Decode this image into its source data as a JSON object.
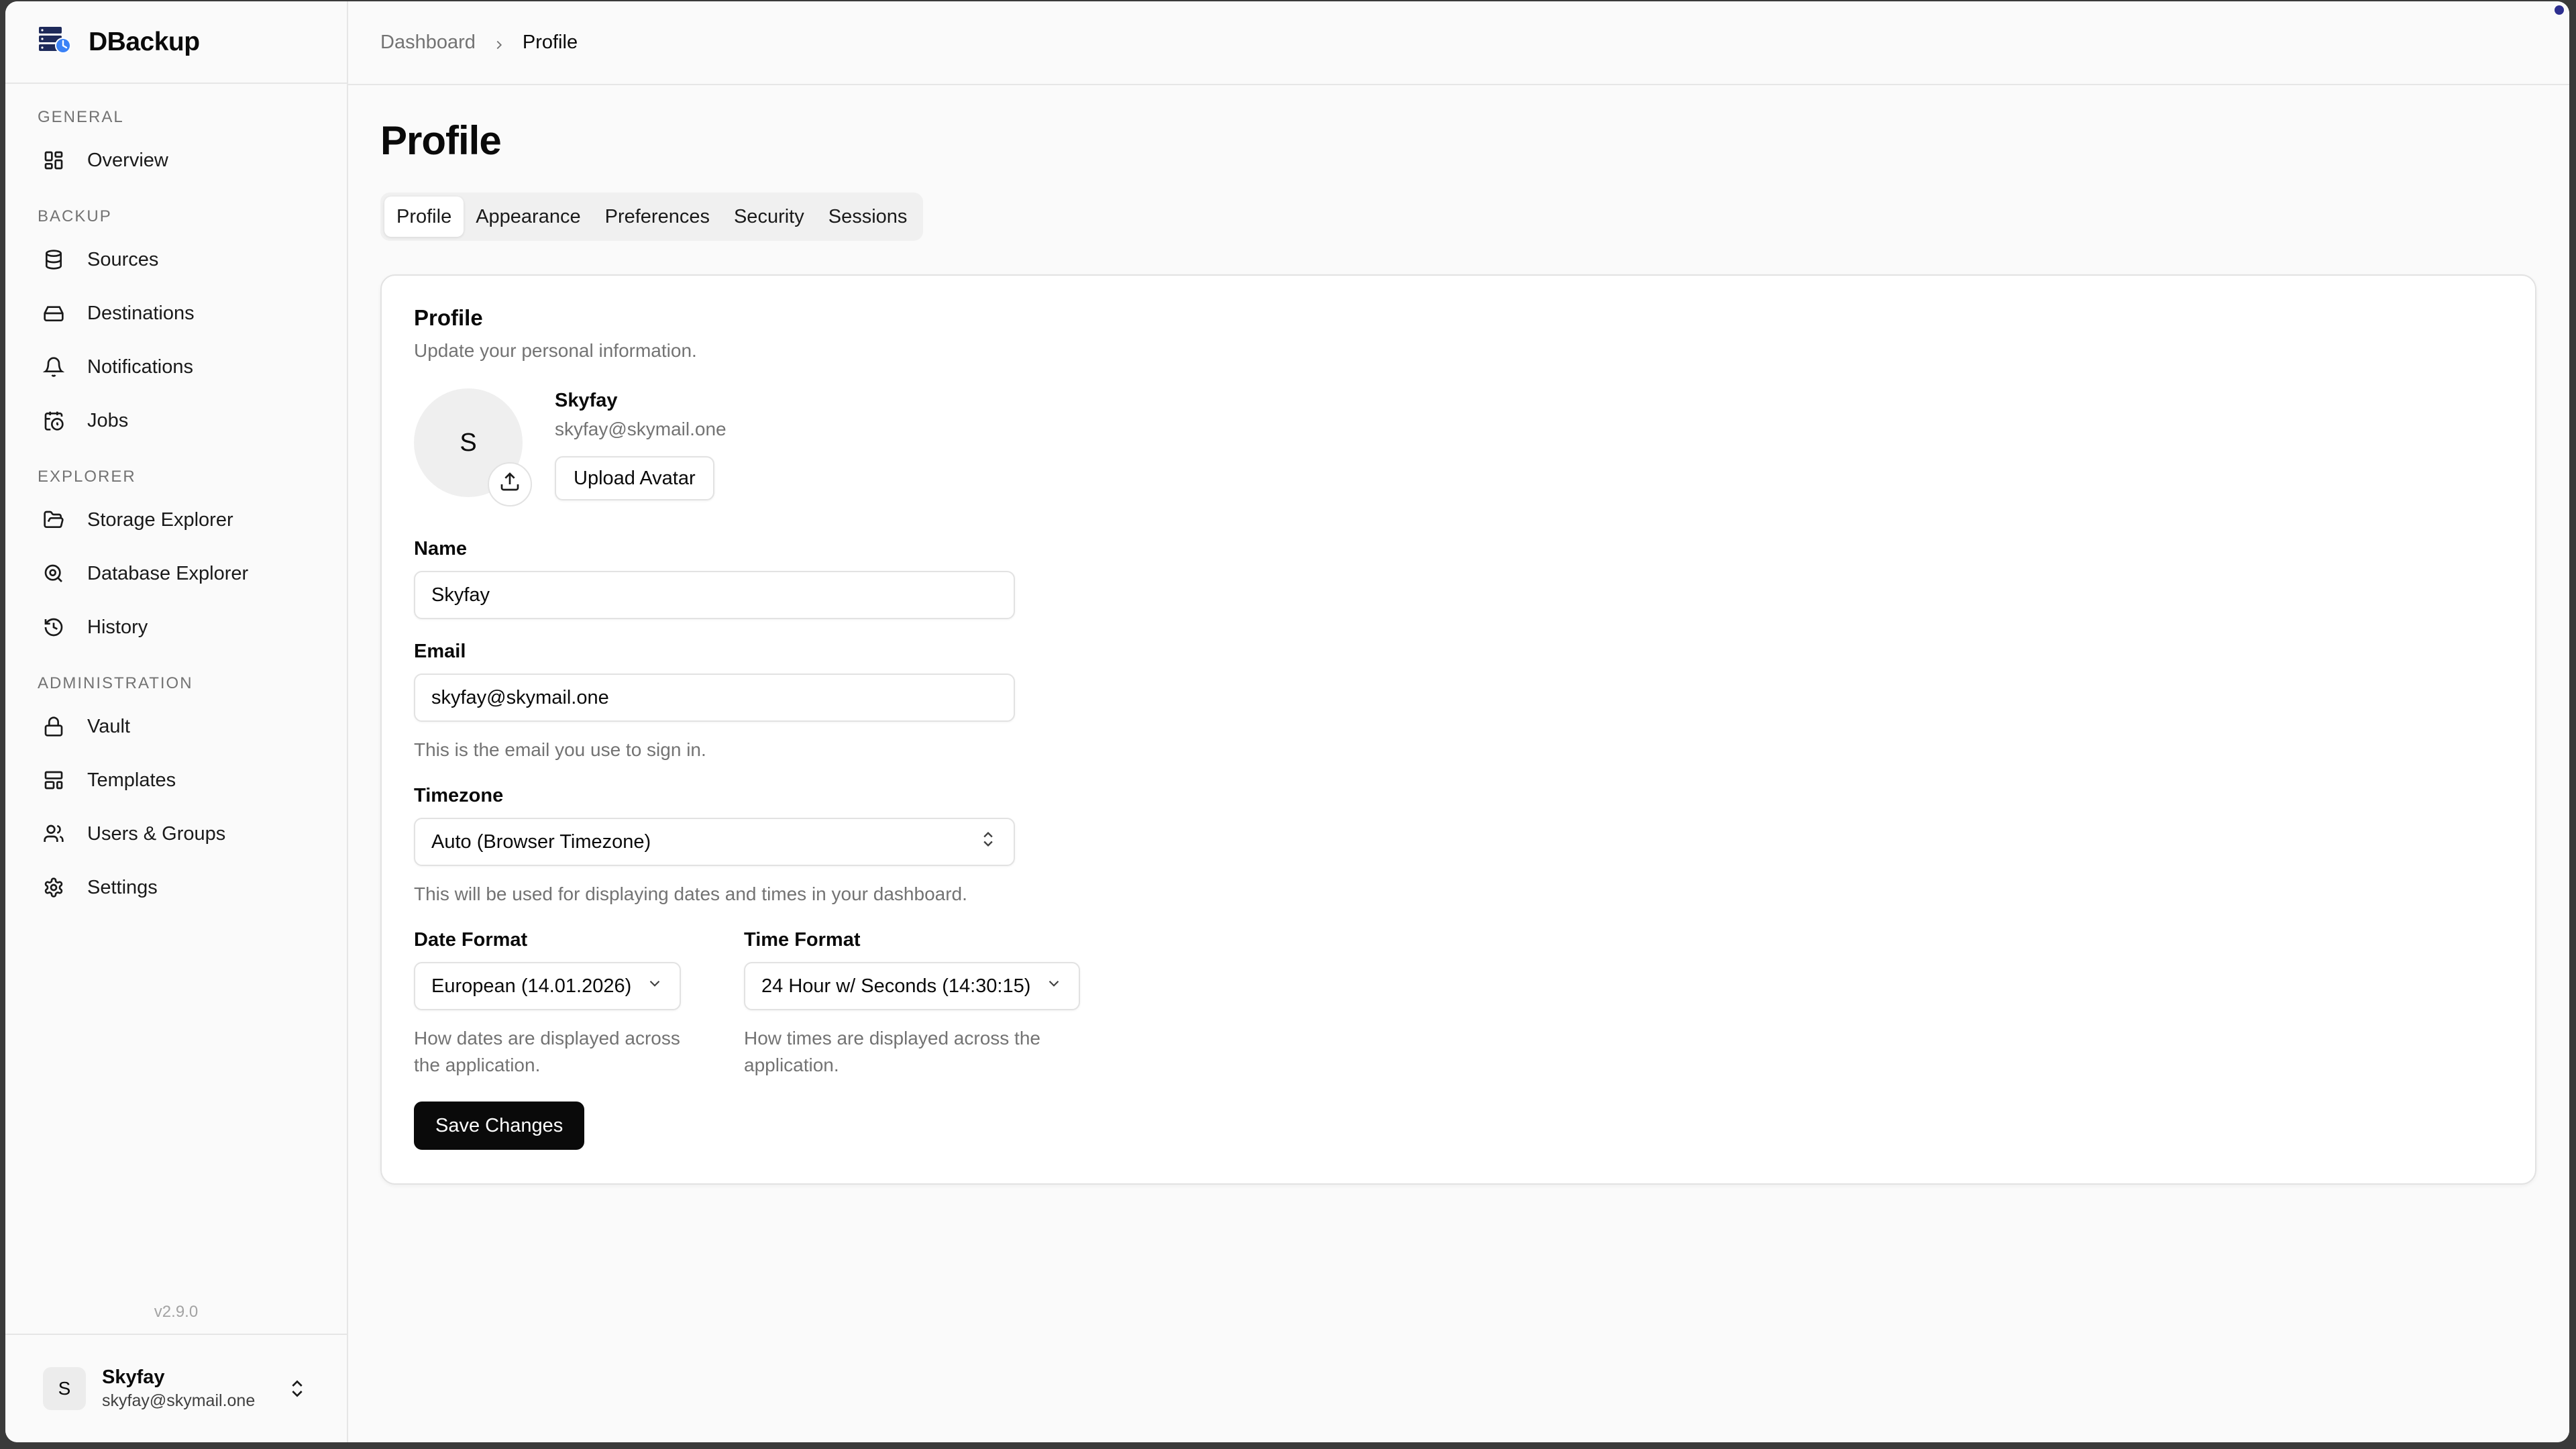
{
  "app": {
    "name": "DBackup",
    "version": "v2.9.0"
  },
  "sidebar": {
    "groups": [
      {
        "label": "GENERAL",
        "items": [
          {
            "label": "Overview",
            "icon": "grid-icon"
          }
        ]
      },
      {
        "label": "BACKUP",
        "items": [
          {
            "label": "Sources",
            "icon": "database-icon"
          },
          {
            "label": "Destinations",
            "icon": "hard-drive-icon"
          },
          {
            "label": "Notifications",
            "icon": "bell-icon"
          },
          {
            "label": "Jobs",
            "icon": "calendar-clock-icon"
          }
        ]
      },
      {
        "label": "EXPLORER",
        "items": [
          {
            "label": "Storage Explorer",
            "icon": "folder-open-icon"
          },
          {
            "label": "Database Explorer",
            "icon": "search-zoom-icon"
          },
          {
            "label": "History",
            "icon": "history-icon"
          }
        ]
      },
      {
        "label": "ADMINISTRATION",
        "items": [
          {
            "label": "Vault",
            "icon": "lock-icon"
          },
          {
            "label": "Templates",
            "icon": "layout-template-icon"
          },
          {
            "label": "Users & Groups",
            "icon": "users-icon"
          },
          {
            "label": "Settings",
            "icon": "gear-icon"
          }
        ]
      }
    ]
  },
  "user": {
    "initial": "S",
    "name": "Skyfay",
    "email": "skyfay@skymail.one"
  },
  "breadcrumb": {
    "parent": "Dashboard",
    "current": "Profile"
  },
  "page": {
    "title": "Profile",
    "tabs": [
      "Profile",
      "Appearance",
      "Preferences",
      "Security",
      "Sessions"
    ],
    "active_tab": "Profile"
  },
  "card": {
    "title": "Profile",
    "description": "Update your personal information.",
    "avatar_initial": "S",
    "display_name": "Skyfay",
    "display_email": "skyfay@skymail.one",
    "upload_label": "Upload Avatar",
    "name_label": "Name",
    "name_value": "Skyfay",
    "email_label": "Email",
    "email_value": "skyfay@skymail.one",
    "email_help": "This is the email you use to sign in.",
    "timezone_label": "Timezone",
    "timezone_value": "Auto (Browser Timezone)",
    "timezone_help": "This will be used for displaying dates and times in your dashboard.",
    "date_format_label": "Date Format",
    "date_format_value": "European (14.01.2026)",
    "date_format_help": "How dates are displayed across the application.",
    "time_format_label": "Time Format",
    "time_format_value": "24 Hour w/ Seconds (14:30:15)",
    "time_format_help": "How times are displayed across the application.",
    "save_label": "Save Changes"
  }
}
